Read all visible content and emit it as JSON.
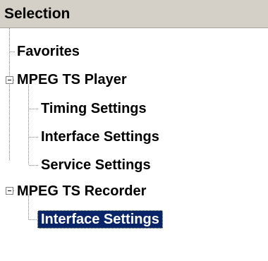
{
  "panel": {
    "title": "Selection"
  },
  "tree": {
    "nodes": [
      {
        "label": "Favorites",
        "level": 0,
        "expandable": false,
        "selected": false
      },
      {
        "label": "MPEG TS Player",
        "level": 0,
        "expandable": true,
        "expanded": true,
        "selected": false
      },
      {
        "label": "Timing Settings",
        "level": 1,
        "expandable": false,
        "selected": false
      },
      {
        "label": "Interface Settings",
        "level": 1,
        "expandable": false,
        "selected": false
      },
      {
        "label": "Service Settings",
        "level": 1,
        "expandable": false,
        "selected": false
      },
      {
        "label": "MPEG TS Recorder",
        "level": 0,
        "expandable": true,
        "expanded": true,
        "selected": false
      },
      {
        "label": "Interface Settings",
        "level": 1,
        "expandable": false,
        "selected": true
      }
    ]
  },
  "colors": {
    "selection_background": "#0a246a",
    "selection_text": "#ffffff",
    "header_background": "#d4d0c8",
    "tree_line": "#808080"
  }
}
